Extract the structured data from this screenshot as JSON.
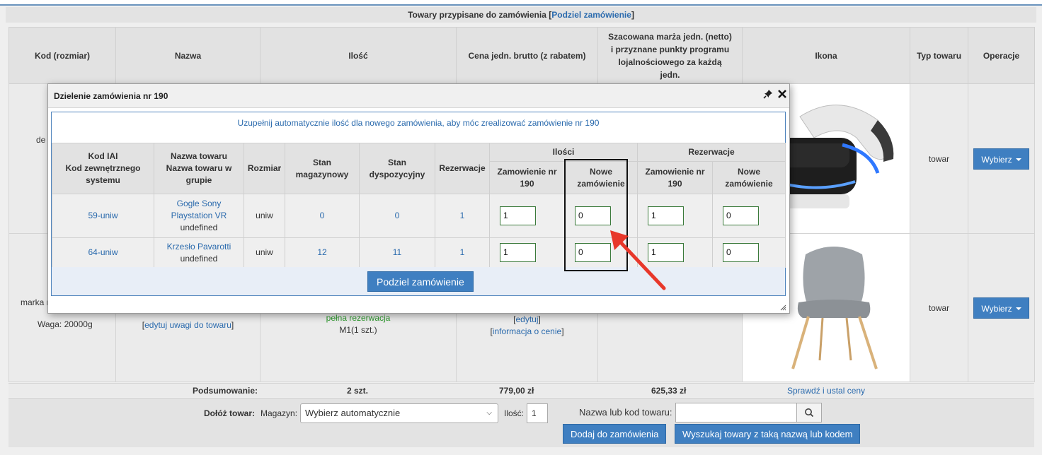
{
  "section": {
    "title": "Towary przypisane do zamówienia",
    "split_link": "Podziel zamówienie"
  },
  "main_table": {
    "headers": {
      "code": "Kod (rozmiar)",
      "name": "Nazwa",
      "quantity": "Ilość",
      "price": "Cena jedn. brutto (z rabatem)",
      "margin": "Szacowana marża jedn. (netto) i przyznane punkty programu lojalnościowego za każdą jedn.",
      "icon": "Ikona",
      "type": "Typ towaru",
      "operations": "Operacje"
    },
    "row1": {
      "code_fragment": "de",
      "type": "towar",
      "action": "Wybierz"
    },
    "row2": {
      "code_fragment": "marka r",
      "weight": "Waga: 20000g",
      "edit_notes_link": "edytuj uwagi do towaru",
      "reservation": "pełna rezerwacja",
      "size_qty": "M1(1 szt.)",
      "edit_link": "edytuj",
      "price_info_link": "informacja o cenie",
      "type": "towar",
      "action": "Wybierz"
    }
  },
  "summary": {
    "label": "Podsumowanie:",
    "quantity": "2 szt.",
    "total_price": "779,00 zł",
    "total_margin": "625,33 zł",
    "check_link": "Sprawdź i ustal ceny"
  },
  "add_bar": {
    "label": "Dołóż towar:",
    "warehouse_label": "Magazyn:",
    "warehouse_value": "Wybierz automatycznie",
    "qty_label": "Ilość:",
    "qty_value": "1",
    "search_label": "Nazwa lub kod towaru:",
    "search_value": "",
    "add_button": "Dodaj do zamówienia",
    "find_button": "Wyszukaj towary z taką nazwą lub kodem"
  },
  "dialog": {
    "title": "Dzielenie zamówienia nr 190",
    "info": "Uzupełnij automatycznie ilość dla nowego zamówienia, aby móc zrealizować zamówienie nr 190",
    "headers": {
      "code": [
        "Kod IAI",
        "Kod zewnętrznego",
        "systemu"
      ],
      "name": [
        "Nazwa towaru",
        "Nazwa towaru w",
        "grupie"
      ],
      "size": "Rozmiar",
      "stock": [
        "Stan",
        "magazynowy"
      ],
      "available": [
        "Stan",
        "dyspozycyjny"
      ],
      "reservation": "Rezerwacje",
      "qty_group": "Ilości",
      "res_group": "Rezerwacje",
      "order": [
        "Zamowienie nr",
        "190"
      ],
      "new_order": [
        "Nowe",
        "zamówienie"
      ]
    },
    "rows": [
      {
        "code": "59-uniw",
        "name_line1": "Gogle Sony",
        "name_line2": "Playstation VR",
        "group": "undefined",
        "size": "uniw",
        "stock": "0",
        "available": "0",
        "reservation": "1",
        "qty_order": "1",
        "qty_new": "0",
        "res_order": "1",
        "res_new": "0"
      },
      {
        "code": "64-uniw",
        "name_line1": "Krzesło Pavarotti",
        "group": "undefined",
        "size": "uniw",
        "stock": "12",
        "available": "11",
        "reservation": "1",
        "qty_order": "1",
        "qty_new": "0",
        "res_order": "1",
        "res_new": "0"
      }
    ],
    "submit": "Podziel zamówienie"
  },
  "colors": {
    "accent": "#3f7fc1",
    "link": "#2a6aad",
    "success": "#2e9a2e",
    "annotation_arrow": "#e8372a"
  }
}
